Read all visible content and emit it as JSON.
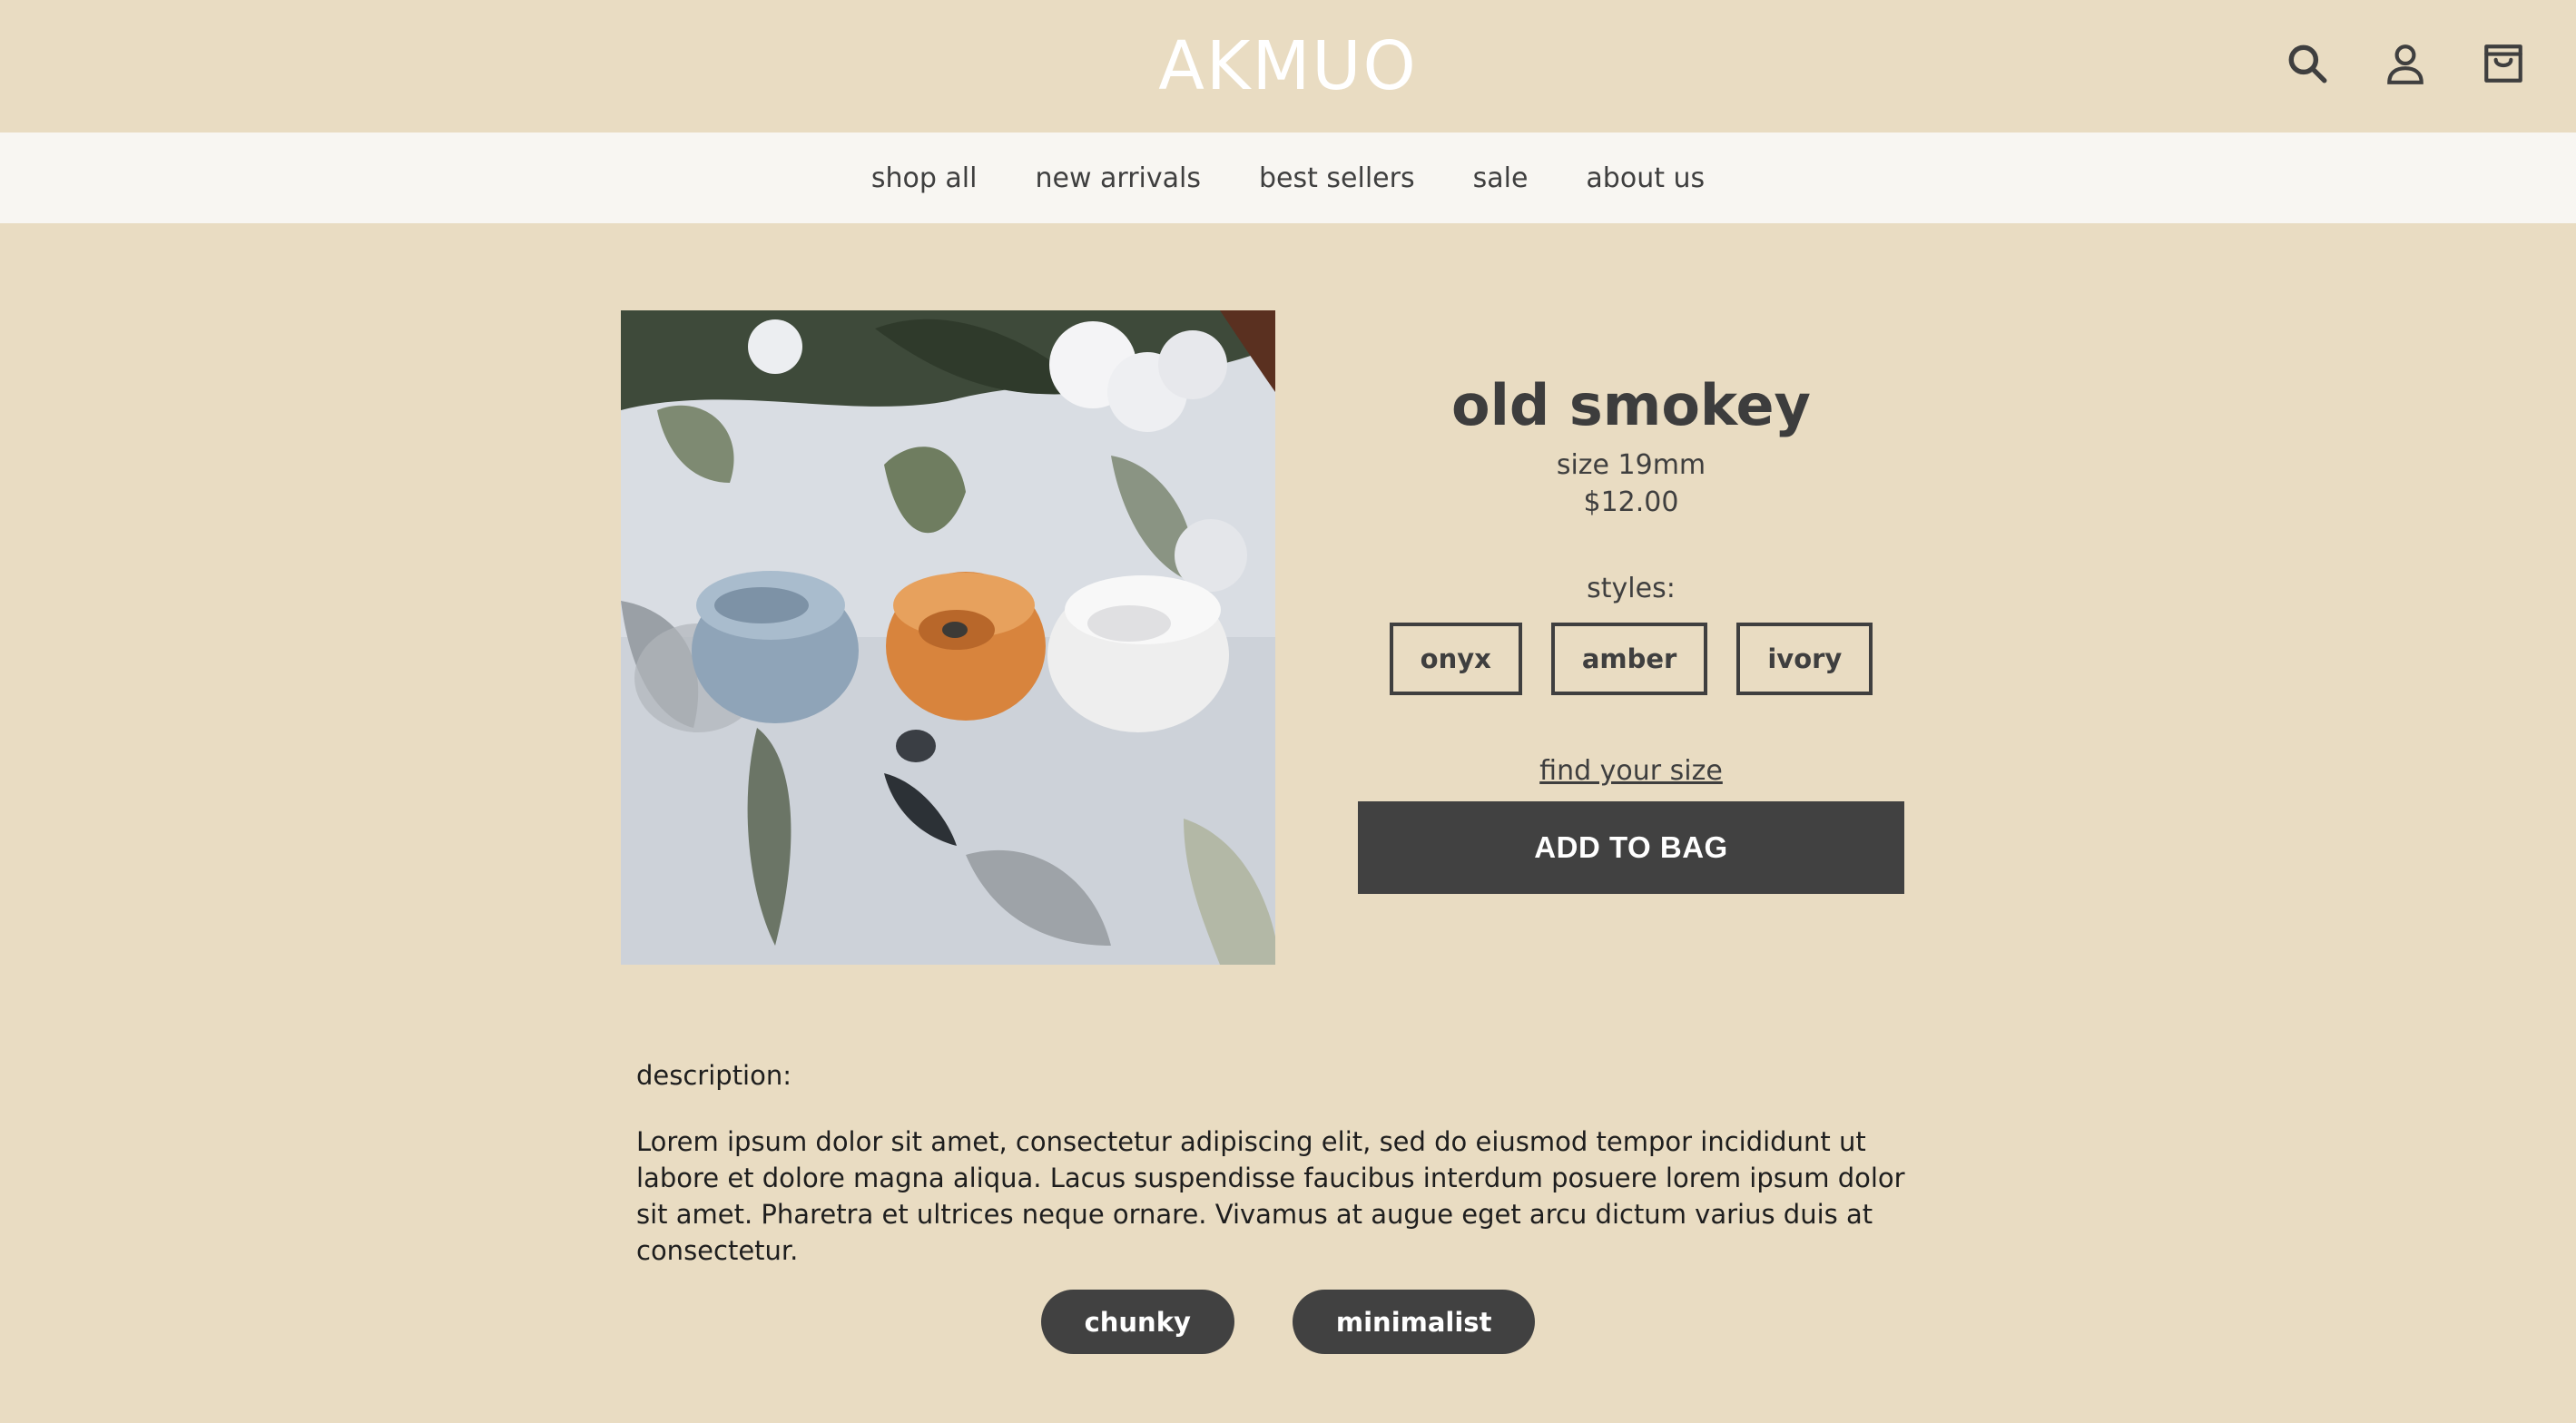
{
  "header": {
    "logo": "AKMUO",
    "icons": [
      "search-icon",
      "account-icon",
      "shopping-bag-icon"
    ]
  },
  "nav": {
    "items": [
      {
        "label": "shop all"
      },
      {
        "label": "new arrivals"
      },
      {
        "label": "best sellers"
      },
      {
        "label": "sale"
      },
      {
        "label": "about us"
      }
    ]
  },
  "product": {
    "title": "old smokey",
    "size": "size 19mm",
    "price": "$12.00",
    "styles_label": "styles:",
    "styles": [
      "onyx",
      "amber",
      "ivory"
    ],
    "find_size": "find your size",
    "add_to_bag": "ADD TO BAG",
    "image_alt": "three resin rings in blue, amber and white"
  },
  "description": {
    "label": "description:",
    "text": "Lorem ipsum dolor sit amet, consectetur adipiscing elit, sed do eiusmod tempor incididunt ut labore et dolore magna aliqua. Lacus suspendisse faucibus interdum posuere lorem ipsum dolor sit amet. Pharetra et ultrices neque ornare. Vivamus at augue eget arcu dictum varius duis at consectetur."
  },
  "tags": [
    "chunky",
    "minimalist"
  ],
  "colors": {
    "background": "#e9dcc2",
    "nav_background": "#f8f6f2",
    "dark": "#414141",
    "text": "#3f3f3f"
  }
}
